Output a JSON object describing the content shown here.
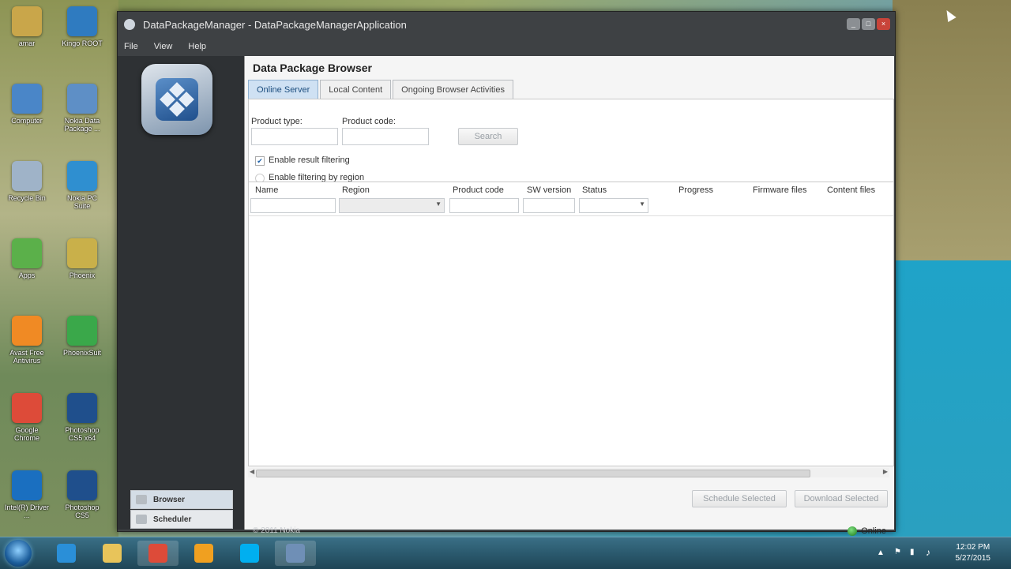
{
  "desktop": {
    "icons": [
      {
        "label": "amar",
        "color": "#c9a64a"
      },
      {
        "label": "Kingo ROOT",
        "color": "#2f7bc0"
      },
      {
        "label": "Computer",
        "color": "#4a86c8"
      },
      {
        "label": "Nokia Data Package ...",
        "color": "#5e8fc6"
      },
      {
        "label": "Recycle Bin",
        "color": "#9fb3c8"
      },
      {
        "label": "Nokia PC Suite",
        "color": "#2f8fd0"
      },
      {
        "label": "Apps",
        "color": "#5bb04a"
      },
      {
        "label": "Phoenix",
        "color": "#c9b04a"
      },
      {
        "label": "Avast Free Antivirus",
        "color": "#f08a24"
      },
      {
        "label": "PhoenixSuit",
        "color": "#3aa84a"
      },
      {
        "label": "Google Chrome",
        "color": "#dd4b39"
      },
      {
        "label": "Photoshop CS5 x64",
        "color": "#1f4f8c"
      },
      {
        "label": "Intel(R) Driver ...",
        "color": "#1a6fc0"
      },
      {
        "label": "Photoshop CS5",
        "color": "#1f4f8c"
      }
    ]
  },
  "window": {
    "title": "DataPackageManager - DataPackageManagerApplication",
    "menu": [
      "File",
      "View",
      "Help"
    ],
    "nav": {
      "browser": "Browser",
      "scheduler": "Scheduler"
    },
    "page_title": "Data Package Browser",
    "tabs": [
      "Online Server",
      "Local Content",
      "Ongoing Browser Activities"
    ],
    "form": {
      "product_type_label": "Product type:",
      "product_code_label": "Product code:",
      "product_type_value": "",
      "product_code_value": "",
      "search_label": "Search",
      "enable_result_filtering": "Enable result filtering",
      "enable_filtering_region": "Enable filtering by region"
    },
    "columns": [
      "Name",
      "Region",
      "Product code",
      "SW version",
      "Status",
      "Progress",
      "Firmware files",
      "Content files"
    ],
    "actions": {
      "schedule": "Schedule Selected",
      "download": "Download Selected"
    },
    "copyright": "© 2011 Nokia",
    "status": "Online"
  },
  "taskbar": {
    "apps": [
      {
        "icon": "internet-explorer-icon",
        "color": "#2a8fd8"
      },
      {
        "icon": "explorer-folder-icon",
        "color": "#e8c45a"
      },
      {
        "icon": "chrome-icon",
        "color": "#dd4b39"
      },
      {
        "icon": "media-player-icon",
        "color": "#f0a020"
      },
      {
        "icon": "skype-icon",
        "color": "#00aff0"
      },
      {
        "icon": "data-package-manager-icon",
        "color": "#6f8fb6"
      }
    ],
    "time": "12:02 PM",
    "date": "5/27/2015"
  }
}
